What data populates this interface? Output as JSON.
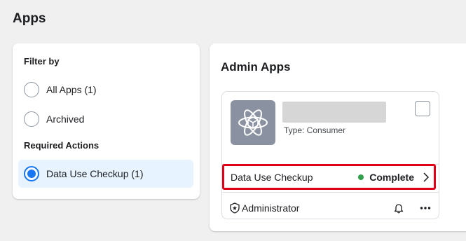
{
  "page": {
    "title": "Apps"
  },
  "filter": {
    "heading": "Filter by",
    "options": [
      {
        "label": "All Apps (1)",
        "selected": false
      },
      {
        "label": "Archived",
        "selected": false
      }
    ],
    "required_actions_heading": "Required Actions",
    "required_actions": [
      {
        "label": "Data Use Checkup (1)",
        "selected": true
      }
    ]
  },
  "admin_apps": {
    "title": "Admin Apps",
    "app": {
      "icon": "atom-icon",
      "type_text": "Type: Consumer",
      "action_label": "Data Use Checkup",
      "status": "Complete",
      "status_color": "#31a24c",
      "role": "Administrator",
      "role_icon": "shield-star-icon"
    }
  },
  "colors": {
    "accent": "#1877f2",
    "highlight_border": "#e0001b",
    "selected_bg": "#e7f3ff"
  }
}
